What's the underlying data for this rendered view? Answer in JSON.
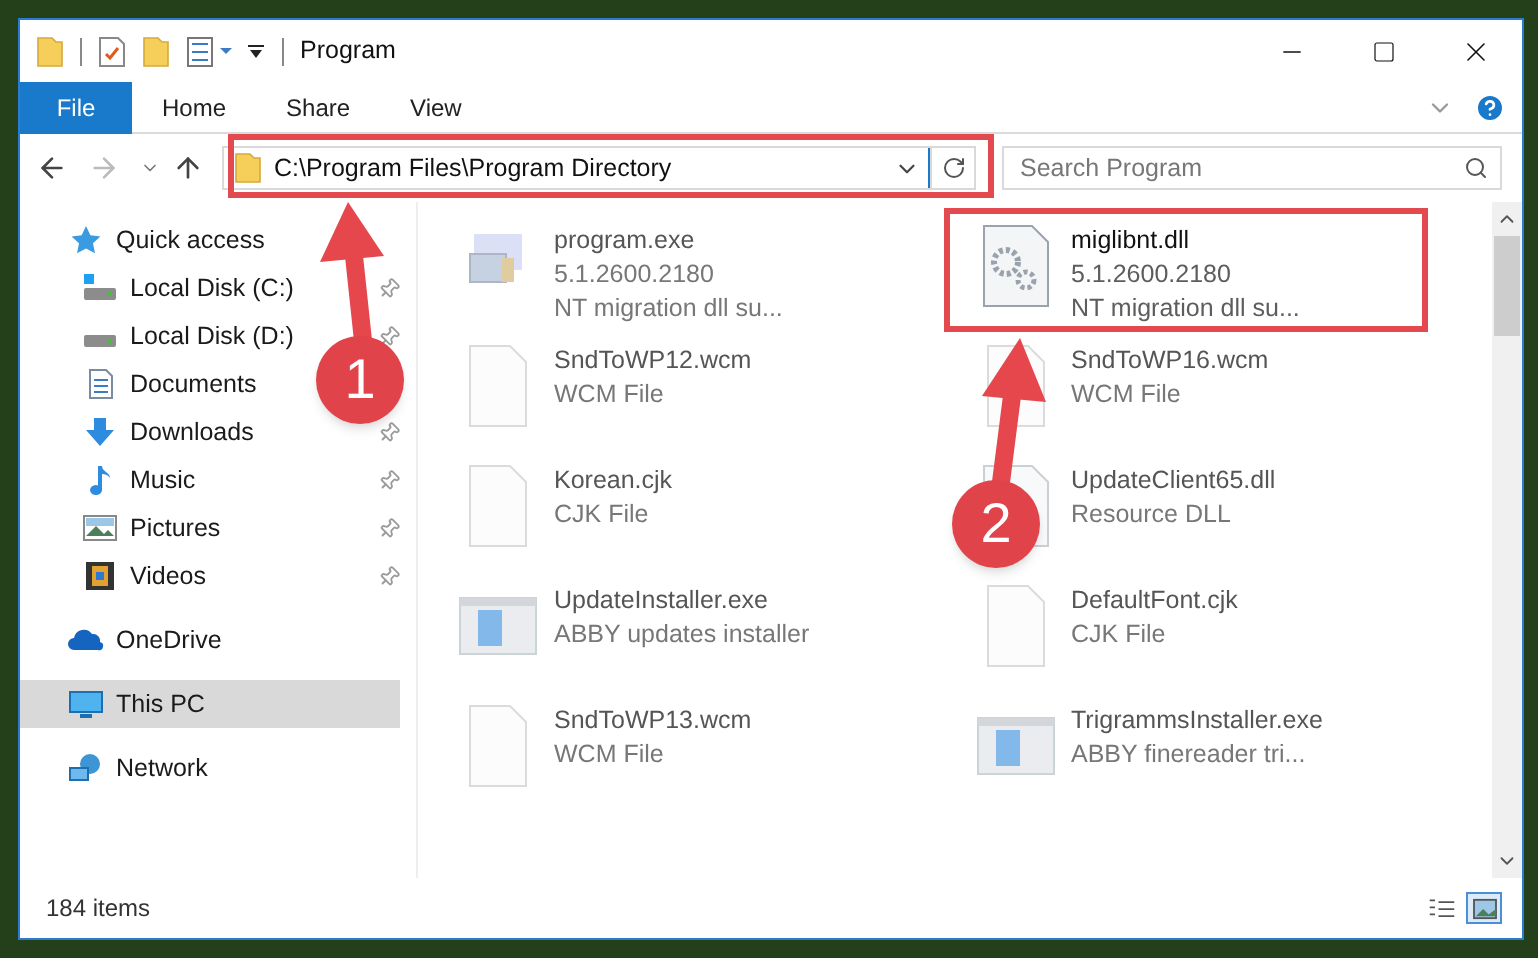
{
  "window": {
    "title": "Program"
  },
  "ribbon_tabs": [
    {
      "label": "File",
      "selected": true
    },
    {
      "label": "Home",
      "selected": false
    },
    {
      "label": "Share",
      "selected": false
    },
    {
      "label": "View",
      "selected": false
    }
  ],
  "address_bar": {
    "path": "C:\\Program Files\\Program Directory"
  },
  "search": {
    "placeholder": "Search Program"
  },
  "sidebar": {
    "items": [
      {
        "label": "Quick access",
        "selected": false,
        "children": [
          {
            "label": "Local Disk (C:)",
            "pinned": true,
            "selected": false
          },
          {
            "label": "Local Disk (D:)",
            "pinned": true,
            "selected": false
          },
          {
            "label": "Documents",
            "selected": false
          },
          {
            "label": "Downloads",
            "pinned": true,
            "selected": false
          },
          {
            "label": "Music",
            "pinned": true,
            "selected": false
          },
          {
            "label": "Pictures",
            "pinned": true,
            "selected": false
          },
          {
            "label": "Videos",
            "pinned": true,
            "selected": false
          }
        ]
      },
      {
        "label": "OneDrive",
        "selected": false
      },
      {
        "label": "This PC",
        "selected": true
      },
      {
        "label": "Network",
        "selected": false
      }
    ]
  },
  "files": [
    {
      "kind": "program",
      "name": "program.exe",
      "details": [
        "5.1.2600.2180",
        "NT migration dll su..."
      ],
      "blurred": true
    },
    {
      "kind": "dll",
      "name": "miglibnt.dll",
      "details": [
        "5.1.2600.2180",
        "NT migration dll su..."
      ],
      "blurred": false
    },
    {
      "kind": "blank",
      "name": "SndToWP12.wcm",
      "details": [
        "WCM File"
      ],
      "blurred": true
    },
    {
      "kind": "blank",
      "name": "SndToWP16.wcm",
      "details": [
        "WCM File"
      ],
      "blurred": true
    },
    {
      "kind": "blank",
      "name": "Korean.cjk",
      "details": [
        "CJK File"
      ],
      "blurred": true
    },
    {
      "kind": "dll",
      "name": "UpdateClient65.dll",
      "details": [
        "Resource DLL"
      ],
      "blurred": true
    },
    {
      "kind": "installer",
      "name": "UpdateInstaller.exe",
      "details": [
        "ABBY updates installer"
      ],
      "blurred": true
    },
    {
      "kind": "blank",
      "name": "DefaultFont.cjk",
      "details": [
        "CJK File"
      ],
      "blurred": true
    },
    {
      "kind": "blank",
      "name": "SndToWP13.wcm",
      "details": [
        "WCM File"
      ],
      "blurred": true
    },
    {
      "kind": "installer",
      "name": "TrigrammsInstaller.exe",
      "details": [
        "ABBY finereader tri..."
      ],
      "blurred": true
    }
  ],
  "status_bar": {
    "item_count": "184 items",
    "view_buttons": [
      {
        "selected": false
      },
      {
        "selected": true
      }
    ]
  },
  "annotations": [
    {
      "number": "1"
    },
    {
      "number": "2"
    }
  ]
}
